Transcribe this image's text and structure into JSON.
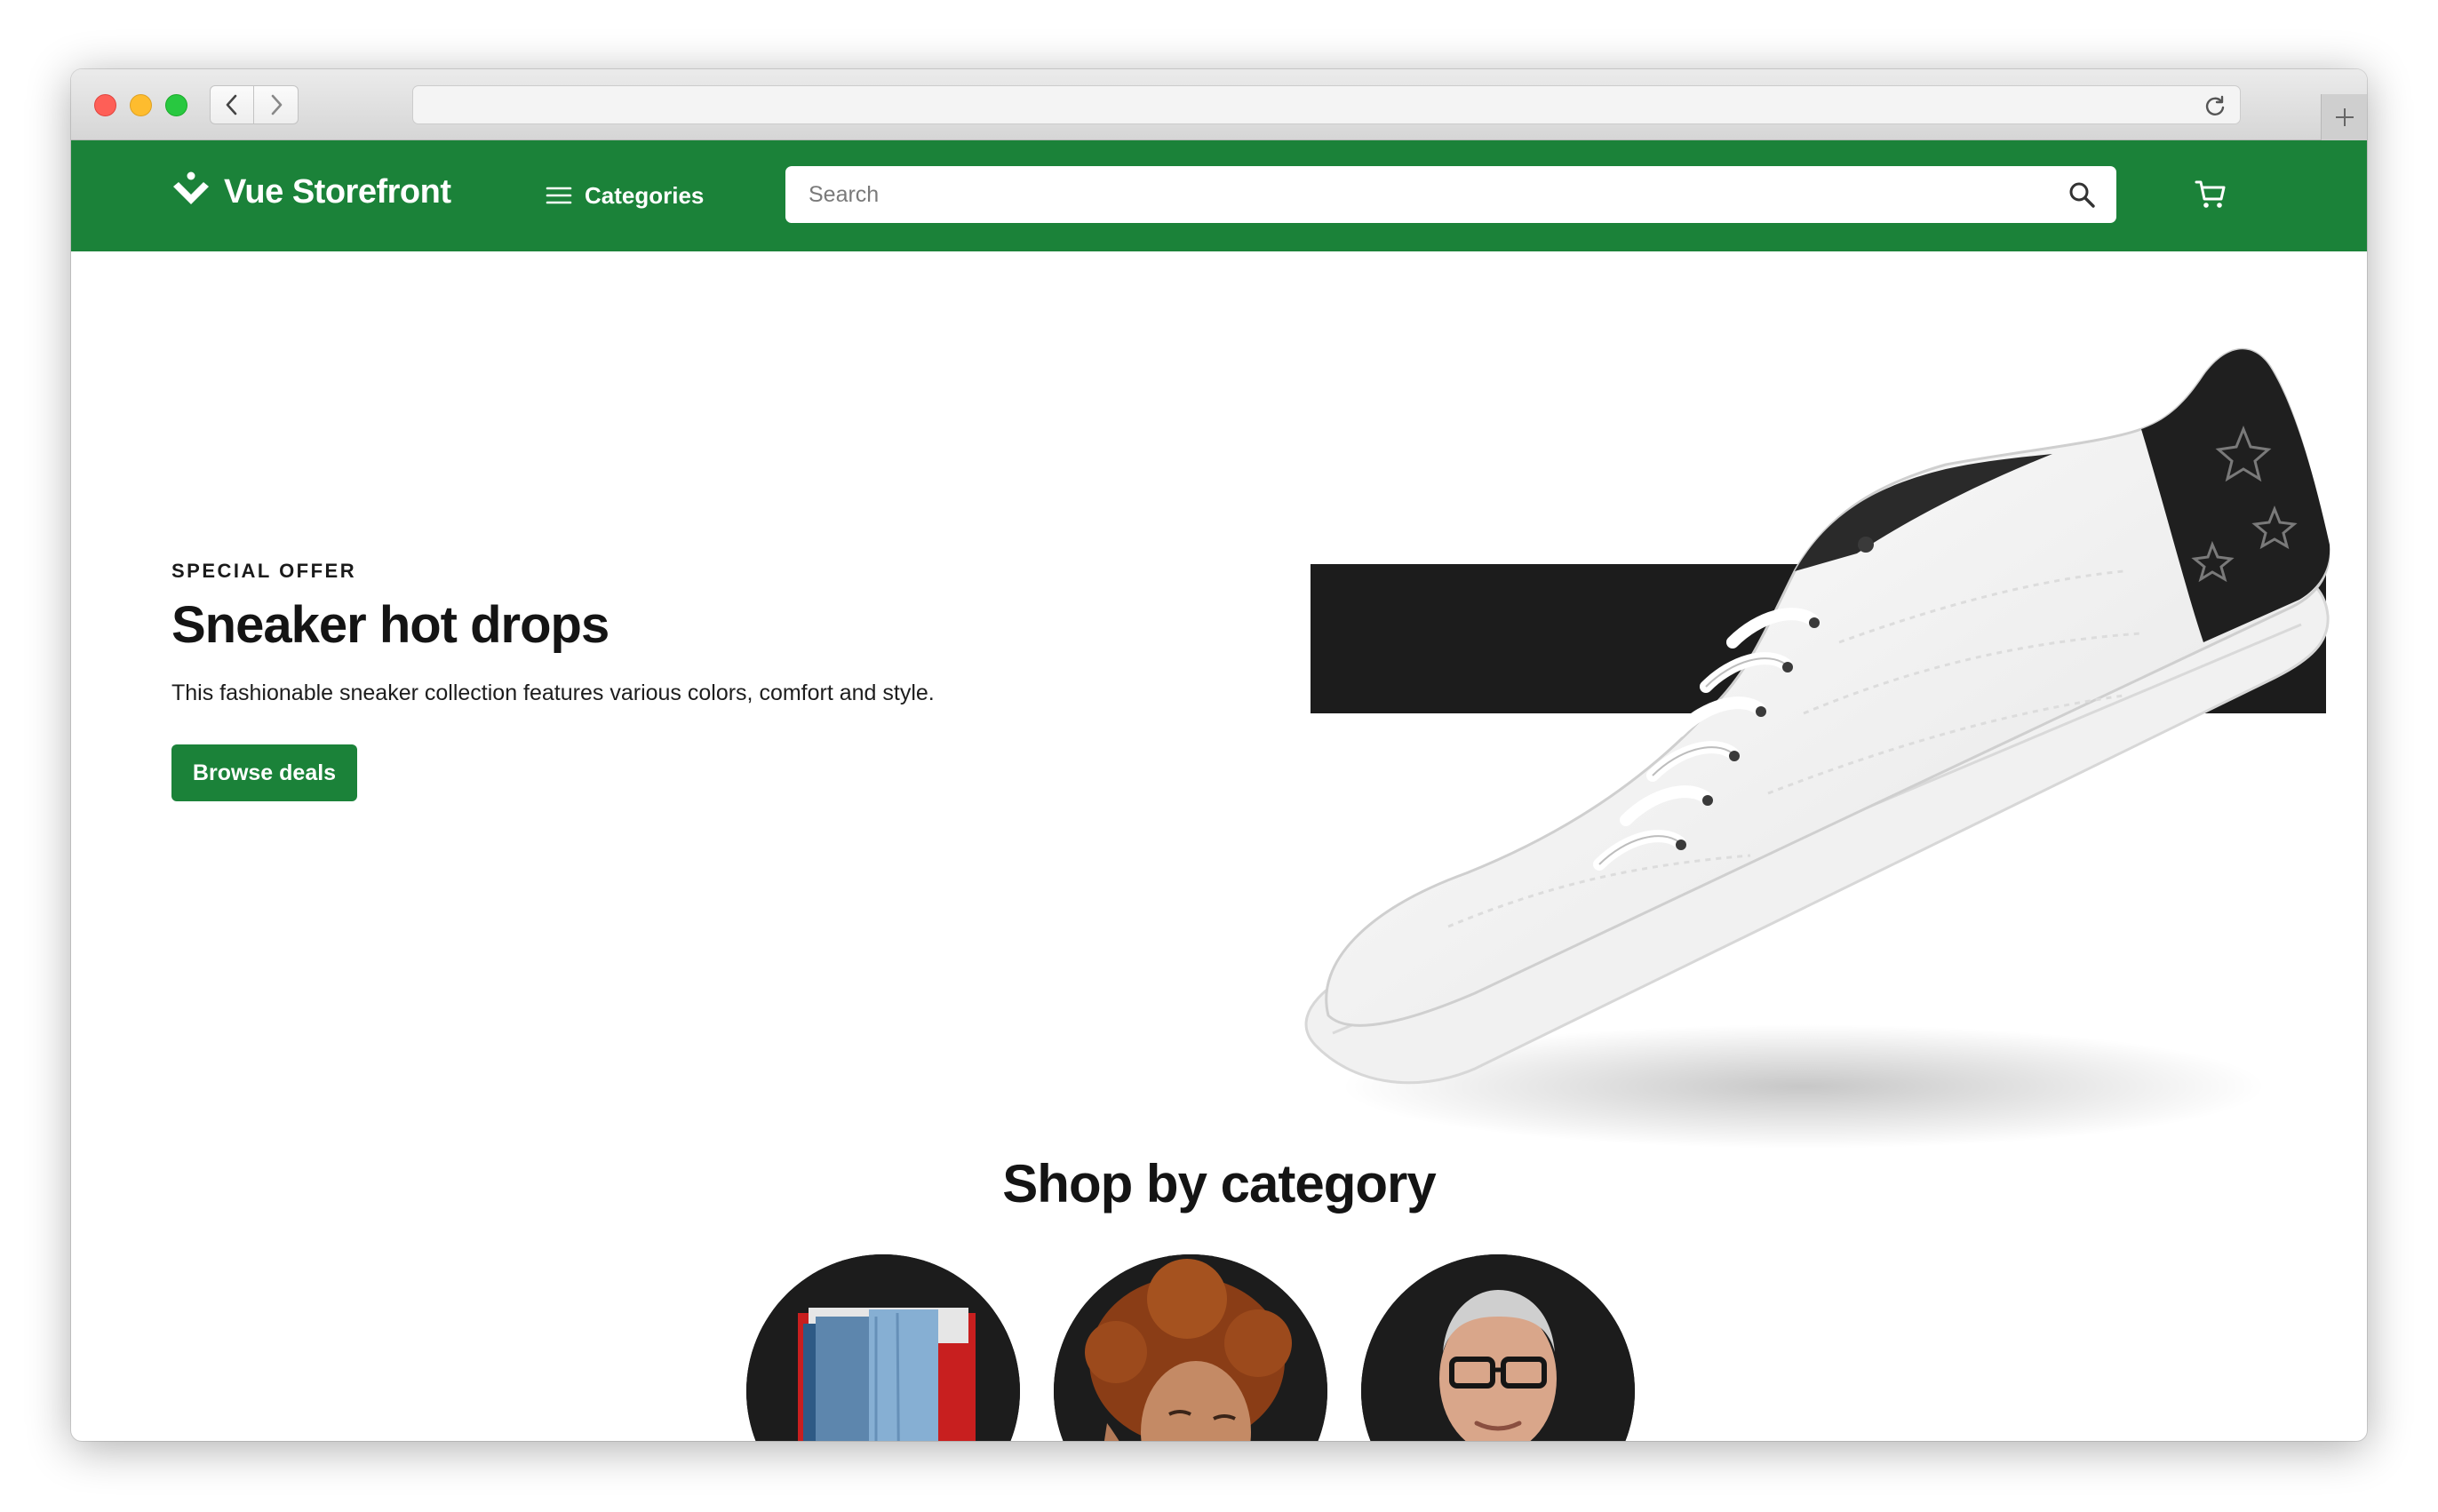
{
  "browser": {
    "url": "",
    "icons": {
      "back": "chevron-left-icon",
      "forward": "chevron-right-icon",
      "reload": "reload-icon",
      "new_tab": "plus-icon"
    }
  },
  "header": {
    "brand": "Vue Storefront",
    "categories_label": "Categories",
    "search_placeholder": "Search",
    "search_value": "",
    "icons": {
      "logo": "vue-storefront-logo-icon",
      "menu": "hamburger-menu-icon",
      "search": "search-icon",
      "cart": "shopping-cart-icon"
    },
    "colors": {
      "header_bg": "#1b8239",
      "accent": "#1b8239"
    }
  },
  "hero": {
    "eyebrow": "SPECIAL OFFER",
    "title": "Sneaker hot drops",
    "description": "This fashionable sneaker collection features various colors, comfort and style.",
    "cta_label": "Browse deals",
    "image": "white-sneaker-with-black-monogram-heel"
  },
  "categories_section": {
    "title": "Shop by category",
    "items": [
      {
        "image": "jeans-photo"
      },
      {
        "image": "woman-portrait-photo"
      },
      {
        "image": "man-with-glasses-photo"
      }
    ]
  }
}
